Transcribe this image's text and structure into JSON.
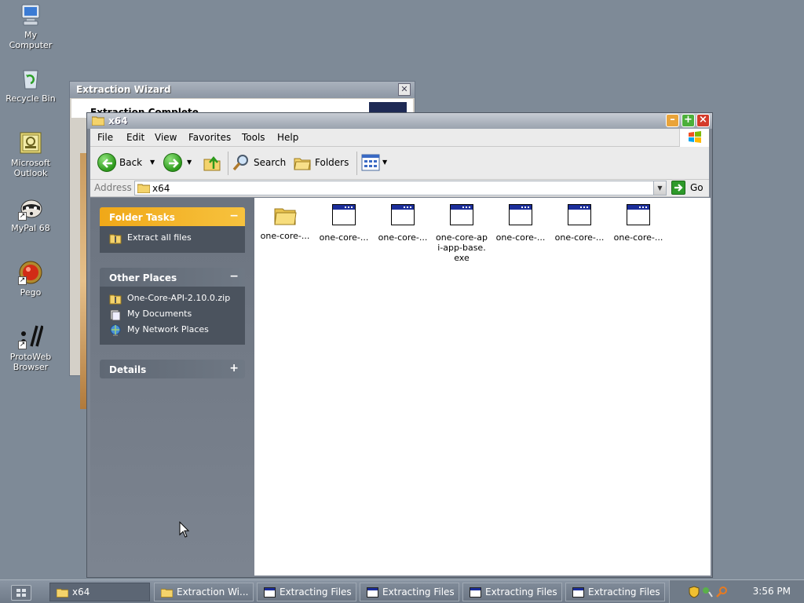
{
  "desktop": {
    "icons": [
      {
        "label_line1": "My",
        "label_line2": "Computer",
        "icon": "my-computer-icon"
      },
      {
        "label_line1": "Recycle Bin",
        "label_line2": "",
        "icon": "recycle-bin-icon"
      },
      {
        "label_line1": "Microsoft",
        "label_line2": "Outlook",
        "icon": "outlook-icon"
      },
      {
        "label_line1": "MyPal 68",
        "label_line2": "",
        "icon": "mypal-icon"
      },
      {
        "label_line1": "Pego",
        "label_line2": "",
        "icon": "pego-icon"
      },
      {
        "label_line1": "ProtoWeb",
        "label_line2": "Browser",
        "icon": "protoweb-icon"
      }
    ]
  },
  "wizard": {
    "title": "Extraction Wizard",
    "heading": "Extraction Complete"
  },
  "explorer": {
    "title": "x64",
    "menu": [
      "File",
      "Edit",
      "View",
      "Favorites",
      "Tools",
      "Help"
    ],
    "toolbar": {
      "back": "Back",
      "search": "Search",
      "folders": "Folders"
    },
    "address": {
      "label": "Address",
      "value": "x64",
      "go": "Go"
    },
    "folder_tasks": {
      "title": "Folder Tasks",
      "toggle": "−",
      "items": [
        "Extract all files"
      ]
    },
    "other_places": {
      "title": "Other Places",
      "toggle": "−",
      "items": [
        "One-Core-API-2.10.0.zip",
        "My Documents",
        "My Network Places"
      ]
    },
    "details": {
      "title": "Details",
      "toggle": "+"
    },
    "files": [
      {
        "line1": "one-core-...",
        "line2": "",
        "line3": "",
        "type": "folder"
      },
      {
        "line1": "one-core-...",
        "line2": "",
        "line3": "",
        "type": "exe"
      },
      {
        "line1": "one-core-...",
        "line2": "",
        "line3": "",
        "type": "exe"
      },
      {
        "line1": "one-core-ap",
        "line2": "i-app-base.",
        "line3": "exe",
        "type": "exe"
      },
      {
        "line1": "one-core-...",
        "line2": "",
        "line3": "",
        "type": "exe"
      },
      {
        "line1": "one-core-...",
        "line2": "",
        "line3": "",
        "type": "exe"
      },
      {
        "line1": "one-core-...",
        "line2": "",
        "line3": "",
        "type": "exe"
      }
    ]
  },
  "taskbar": {
    "tasks": [
      {
        "label": "x64",
        "active": true
      },
      {
        "label": "Extraction Wi...",
        "active": false
      },
      {
        "label": "Extracting Files",
        "active": false
      },
      {
        "label": "Extracting Files",
        "active": false
      },
      {
        "label": "Extracting Files",
        "active": false
      },
      {
        "label": "Extracting Files",
        "active": false
      }
    ],
    "clock": "3:56 PM"
  }
}
